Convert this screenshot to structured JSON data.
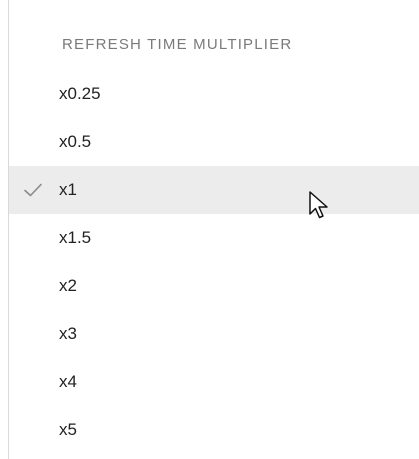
{
  "menu": {
    "header": "REFRESH TIME MULTIPLIER",
    "items": [
      {
        "label": "x0.25",
        "selected": false
      },
      {
        "label": "x0.5",
        "selected": false
      },
      {
        "label": "x1",
        "selected": true
      },
      {
        "label": "x1.5",
        "selected": false
      },
      {
        "label": "x2",
        "selected": false
      },
      {
        "label": "x3",
        "selected": false
      },
      {
        "label": "x4",
        "selected": false
      },
      {
        "label": "x5",
        "selected": false
      }
    ],
    "selected_icon": "checkmark-icon"
  },
  "cursor_icon": "mouse-pointer-icon",
  "colors": {
    "header_text": "#7a7a7a",
    "item_text": "#222222",
    "selected_bg": "#ececec",
    "checkmark": "#8a8a8a",
    "border": "#d9d9d9"
  }
}
